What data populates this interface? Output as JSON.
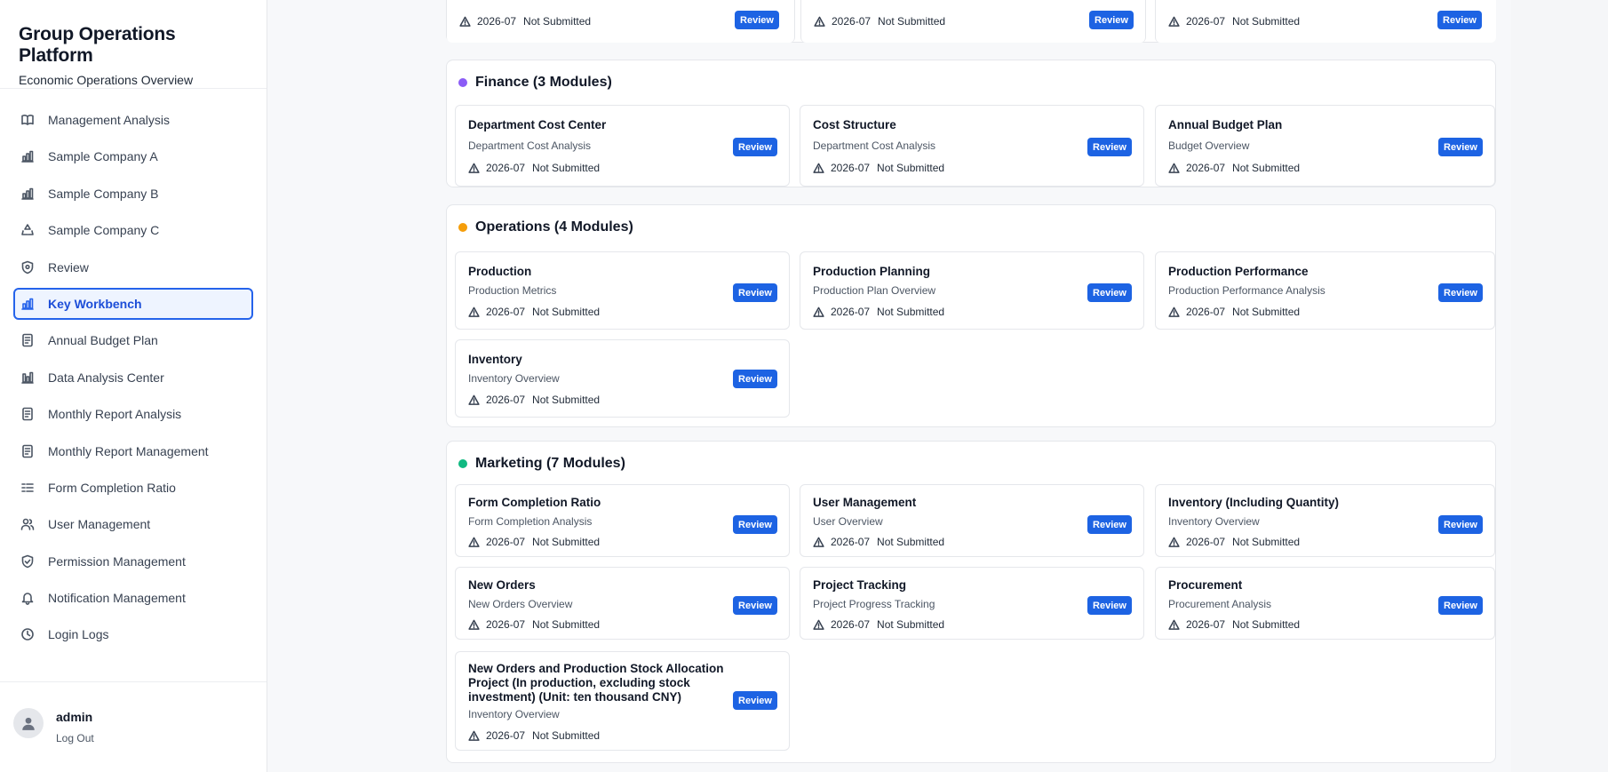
{
  "app": {
    "title": "Group Operations Platform",
    "subtitle": "Economic Operations Overview"
  },
  "sidebar": {
    "items": [
      {
        "label": "Management Analysis",
        "icon": "book-icon"
      },
      {
        "label": "Sample Company A",
        "icon": "bar-chart-icon"
      },
      {
        "label": "Sample Company B",
        "icon": "bar-chart-icon"
      },
      {
        "label": "Sample Company C",
        "icon": "recycle-icon"
      },
      {
        "label": "Review",
        "icon": "shield-icon"
      },
      {
        "label": "Key Workbench",
        "icon": "bar-chart-icon",
        "active": true
      },
      {
        "label": "Annual Budget Plan",
        "icon": "document-icon"
      },
      {
        "label": "Data Analysis Center",
        "icon": "bar-chart-icon"
      },
      {
        "label": "Monthly Report Analysis",
        "icon": "document-icon"
      },
      {
        "label": "Monthly Report Management",
        "icon": "document-icon"
      },
      {
        "label": "Form Completion Ratio",
        "icon": "list-icon"
      },
      {
        "label": "User Management",
        "icon": "users-icon"
      },
      {
        "label": "Permission Management",
        "icon": "shield-check-icon"
      },
      {
        "label": "Notification Management",
        "icon": "bell-icon"
      },
      {
        "label": "Login Logs",
        "icon": "clock-icon"
      }
    ]
  },
  "user": {
    "name": "admin",
    "logout_label": "Log Out"
  },
  "common": {
    "period": "2026-07",
    "status": "Not Submitted",
    "review_label": "Review"
  },
  "top_row": {
    "cards": [
      {
        "period": "2026-07",
        "status": "Not Submitted"
      },
      {
        "period": "2026-07",
        "status": "Not Submitted"
      },
      {
        "period": "2026-07",
        "status": "Not Submitted"
      }
    ]
  },
  "sections": [
    {
      "title": "Finance (3 Modules)",
      "color": "#8b5cf6",
      "cards": [
        {
          "title": "Department Cost Center",
          "subtitle": "Department Cost Analysis"
        },
        {
          "title": "Cost Structure",
          "subtitle": "Department Cost Analysis"
        },
        {
          "title": "Annual Budget Plan",
          "subtitle": "Budget Overview"
        }
      ]
    },
    {
      "title": "Operations (4 Modules)",
      "color": "#f59e0b",
      "cards": [
        {
          "title": "Production",
          "subtitle": "Production Metrics"
        },
        {
          "title": "Production Planning",
          "subtitle": "Production Plan Overview"
        },
        {
          "title": "Production Performance",
          "subtitle": "Production Performance Analysis"
        },
        {
          "title": "Inventory",
          "subtitle": "Inventory Overview"
        }
      ]
    },
    {
      "title": "Marketing (7 Modules)",
      "color": "#10b981",
      "cards": [
        {
          "title": "Form Completion Ratio",
          "subtitle": "Form Completion Analysis"
        },
        {
          "title": "User Management",
          "subtitle": "User Overview"
        },
        {
          "title": "Inventory (Including Quantity)",
          "subtitle": "Inventory Overview"
        },
        {
          "title": "New Orders",
          "subtitle": "New Orders Overview"
        },
        {
          "title": "Project Tracking",
          "subtitle": "Project Progress Tracking"
        },
        {
          "title": "Procurement",
          "subtitle": "Procurement Analysis"
        },
        {
          "title": "New Orders and Production Stock Allocation Project (In production, excluding stock investment) (Unit: ten thousand CNY)",
          "subtitle": "Inventory Overview"
        }
      ]
    }
  ]
}
